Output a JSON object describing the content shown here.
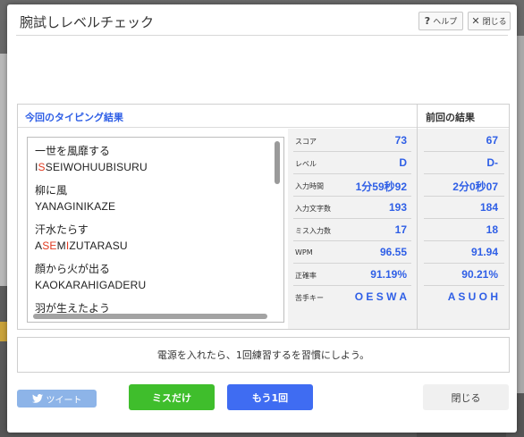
{
  "modal": {
    "title": "腕試しレベルチェック",
    "help_label": "ヘルプ",
    "close_label": "閉じる"
  },
  "results": {
    "current_title": "今回のタイピング結果",
    "previous_title": "前回の結果",
    "words": [
      {
        "jp": "一世を風靡する",
        "roman_parts": [
          {
            "t": "I",
            "miss": false
          },
          {
            "t": "S",
            "miss": true
          },
          {
            "t": "SEIWOHUUBISURU",
            "miss": false
          }
        ]
      },
      {
        "jp": "柳に風",
        "roman_parts": [
          {
            "t": "YANAGINIKAZE",
            "miss": false
          }
        ]
      },
      {
        "jp": "汗水たらす",
        "roman_parts": [
          {
            "t": "A",
            "miss": false
          },
          {
            "t": "SE",
            "miss": true
          },
          {
            "t": "M",
            "miss": false
          },
          {
            "t": "I",
            "miss": true
          },
          {
            "t": "ZUTARASU",
            "miss": false
          }
        ]
      },
      {
        "jp": "顔から火が出る",
        "roman_parts": [
          {
            "t": "KAOKARAHIGADERU",
            "miss": false
          }
        ]
      },
      {
        "jp": "羽が生えたよう",
        "roman_parts": [
          {
            "t": "",
            "miss": false
          }
        ]
      }
    ],
    "stats": [
      {
        "label": "スコア",
        "current": "73",
        "previous": "67"
      },
      {
        "label": "レベル",
        "current": "D",
        "previous": "D-"
      },
      {
        "label": "入力時間",
        "current": "1分59秒92",
        "previous": "2分0秒07"
      },
      {
        "label": "入力文字数",
        "current": "193",
        "previous": "184"
      },
      {
        "label": "ミス入力数",
        "current": "17",
        "previous": "18"
      },
      {
        "label": "WPM",
        "current": "96.55",
        "previous": "91.94"
      },
      {
        "label": "正確率",
        "current": "91.19%",
        "previous": "90.21%"
      },
      {
        "label": "苦手キー",
        "current": "O E S W A",
        "previous": "A S U O H"
      }
    ]
  },
  "advice": "電源を入れたら、1回練習するを習慣にしよう。",
  "buttons": {
    "tweet": "ツイート",
    "miss_only": "ミスだけ",
    "again": "もう1回",
    "close": "閉じる"
  },
  "colors": {
    "accent_blue": "#2f5fe6",
    "miss_red": "#e0391f",
    "green": "#3fbe2c",
    "blue_button": "#3f6cf2",
    "tweet_blue": "#8db4e8"
  }
}
